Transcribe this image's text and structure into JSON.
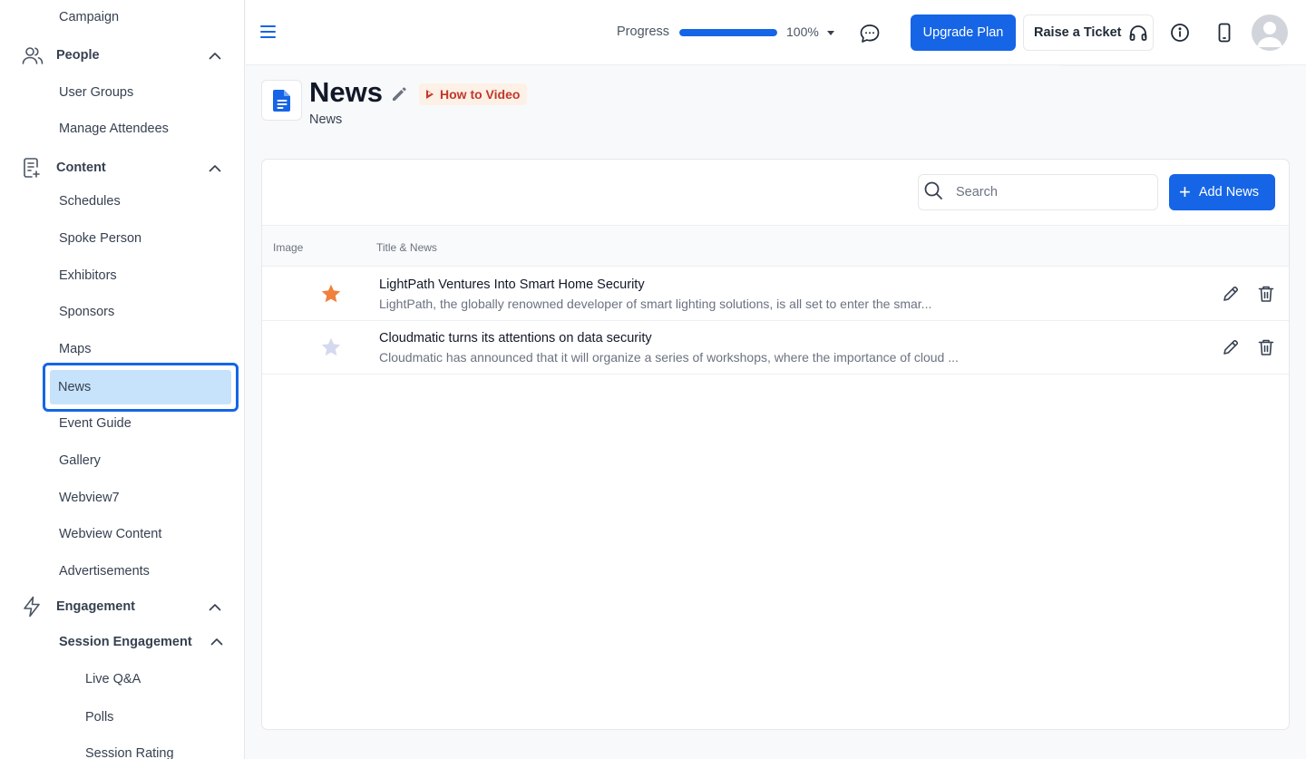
{
  "sidebar": {
    "campaign": "Campaign",
    "people": {
      "label": "People",
      "items": [
        "User Groups",
        "Manage Attendees"
      ]
    },
    "content": {
      "label": "Content",
      "items": [
        "Schedules",
        "Spoke Person",
        "Exhibitors",
        "Sponsors",
        "Maps",
        "News",
        "Event Guide",
        "Gallery",
        "Webview7",
        "Webview Content",
        "Advertisements"
      ]
    },
    "engagement": {
      "label": "Engagement",
      "session_engagement": {
        "label": "Session Engagement",
        "items": [
          "Live Q&A",
          "Polls",
          "Session Rating"
        ]
      }
    }
  },
  "header": {
    "progress_label": "Progress",
    "progress_value": 100,
    "progress_text": "100%",
    "upgrade_label": "Upgrade Plan",
    "ticket_label": "Raise a Ticket"
  },
  "page": {
    "title": "News",
    "subtitle": "News",
    "how_to_video": "How to Video"
  },
  "toolbar": {
    "search_placeholder": "Search",
    "add_label": "Add News"
  },
  "table": {
    "columns": [
      "Image",
      "Title & News"
    ],
    "rows": [
      {
        "title": "LightPath Ventures Into Smart Home Security",
        "description": "LightPath, the globally renowned developer of smart lighting solutions, is all set to enter the smar...",
        "starred": true
      },
      {
        "title": "Cloudmatic turns its attentions on data security",
        "description": "Cloudmatic has announced that it will organize a series of workshops, where the importance of cloud ...",
        "starred": false
      }
    ]
  },
  "colors": {
    "primary": "#1565e6",
    "star_active": "#f0803c",
    "star_inactive": "#d5d9ee",
    "active_bg": "#c7e3fb",
    "danger_text": "#c0392b"
  }
}
